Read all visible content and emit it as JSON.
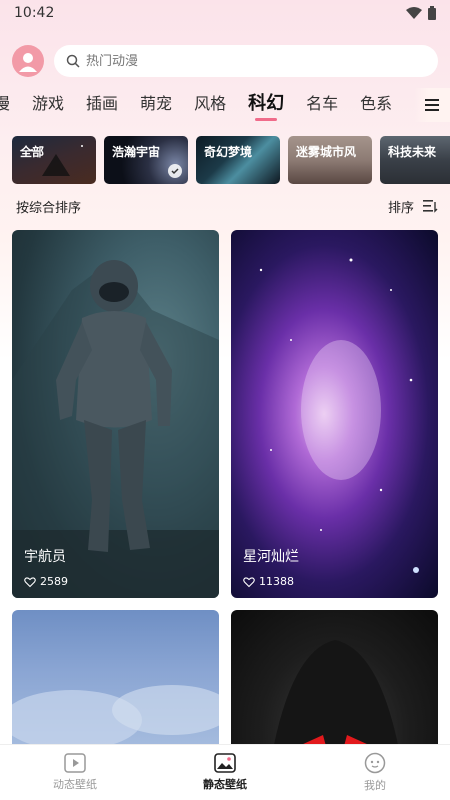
{
  "status": {
    "time": "10:42"
  },
  "search": {
    "placeholder": "热门动漫"
  },
  "categories": [
    "漫",
    "游戏",
    "插画",
    "萌宠",
    "风格",
    "科幻",
    "名车",
    "色系"
  ],
  "active_category": "科幻",
  "sub_categories": [
    {
      "label": "全部"
    },
    {
      "label": "浩瀚宇宙",
      "selected": true
    },
    {
      "label": "奇幻梦境"
    },
    {
      "label": "迷雾城市风"
    },
    {
      "label": "科技未来"
    }
  ],
  "sort": {
    "left_label": "按综合排序",
    "right_label": "排序"
  },
  "wallpapers": [
    {
      "title": "宇航员",
      "likes": "2589"
    },
    {
      "title": "星河灿烂",
      "likes": "11388"
    },
    {
      "title": "",
      "likes": ""
    },
    {
      "title": "",
      "likes": ""
    }
  ],
  "bottom_nav": [
    {
      "label": "动态壁纸",
      "icon": "play-video-icon"
    },
    {
      "label": "静态壁纸",
      "icon": "image-icon",
      "active": true
    },
    {
      "label": "我的",
      "icon": "face-icon"
    }
  ],
  "colors": {
    "accent": "#f06b8a"
  }
}
